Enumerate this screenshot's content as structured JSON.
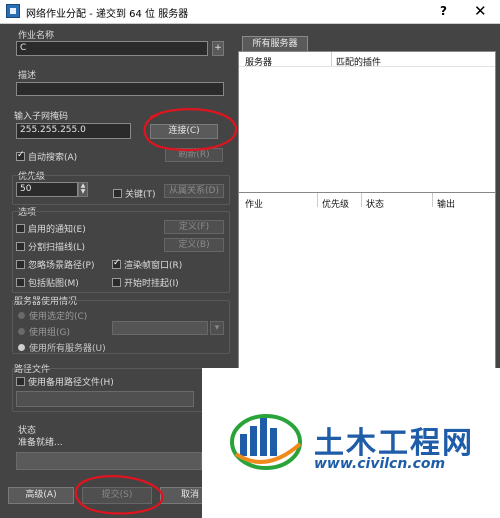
{
  "window": {
    "title": "网络作业分配 - 递交到 64 位 服务器",
    "help_label": "?",
    "close_label": "✕"
  },
  "job": {
    "name_label": "作业名称",
    "name_value": "C",
    "plus_label": "+",
    "desc_label": "描述",
    "desc_value": ""
  },
  "subnet": {
    "label": "输入子网掩码",
    "value": "255.255.255.0",
    "connect_label": "连接(C)",
    "refresh_label": "刷新(R)",
    "auto_search_label": "自动搜索(A)",
    "auto_search_checked": true
  },
  "priority": {
    "label": "优先级",
    "value": "50",
    "critical_label": "关键(T)",
    "critical_checked": false,
    "dependency_label": "从属关系(D)"
  },
  "options": {
    "label": "选项",
    "notify_label": "启用的通知(E)",
    "notify_checked": false,
    "define1_label": "定义(F)",
    "split_label": "分割扫描线(L)",
    "split_checked": false,
    "define2_label": "定义(B)",
    "ignore_path_label": "忽略场景路径(P)",
    "ignore_path_checked": false,
    "render_window_label": "渲染帧窗口(R)",
    "render_window_checked": true,
    "include_maps_label": "包括贴图(M)",
    "include_maps_checked": false,
    "suspend_label": "开始时挂起(I)",
    "suspend_checked": false
  },
  "server_usage": {
    "label": "服务器使用情况",
    "use_selected_label": "使用选定的(C)",
    "use_group_label": "使用组(G)",
    "group_value": "",
    "use_all_label": "使用所有服务器(U)",
    "selected_option": "use_all"
  },
  "path": {
    "label": "路径文件",
    "use_alt_label": "使用备用路径文件(H)",
    "use_alt_checked": false,
    "path_value": ""
  },
  "status": {
    "label": "状态",
    "text": "准备就绪..."
  },
  "buttons": {
    "advanced_label": "高级(A)",
    "submit_label": "提交(S)",
    "cancel_label": "取消"
  },
  "servers_panel": {
    "tab_label": "所有服务器",
    "col_server": "服务器",
    "col_plugin": "匹配的插件"
  },
  "jobs_panel": {
    "col_job": "作业",
    "col_priority": "优先级",
    "col_status": "状态",
    "col_output": "输出"
  },
  "watermark": {
    "brand": "土木工程网",
    "url": "www.civilcn.com"
  },
  "colors": {
    "dialog_bg": "#444444",
    "annotation_red": "#e0141e",
    "watermark_blue": "#1f5da8"
  }
}
